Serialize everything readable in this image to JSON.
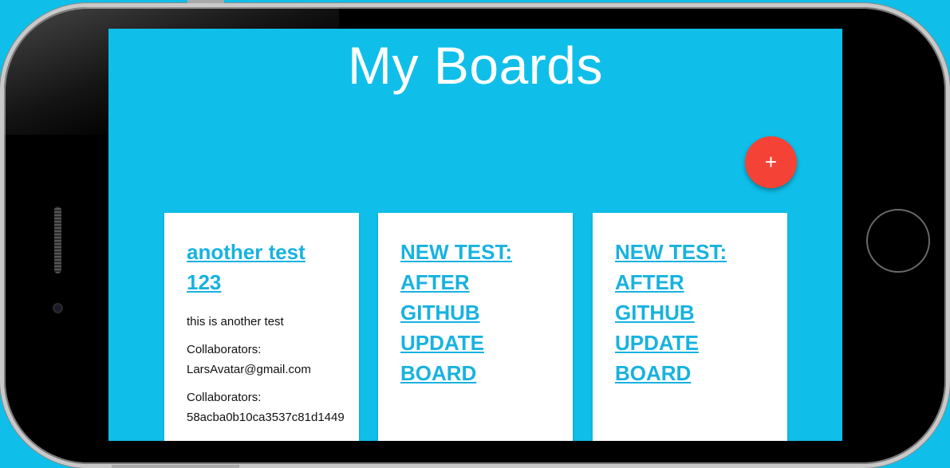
{
  "page": {
    "title": "My Boards"
  },
  "fab": {
    "label": "+"
  },
  "boards": [
    {
      "title_line1": "another test",
      "title_line2": "123",
      "description": "this is another test",
      "collab1_label": "Collaborators:",
      "collab1_value": "LarsAvatar@gmail.com",
      "collab2_label": "Collaborators:",
      "collab2_value": "58acba0b10ca3537c81d1449"
    },
    {
      "title_lines": [
        "NEW TEST:",
        "AFTER",
        "GITHUB",
        "UPDATE",
        "BOARD"
      ]
    },
    {
      "title_lines": [
        "NEW TEST:",
        "AFTER",
        "GITHUB",
        "UPDATE",
        "BOARD"
      ]
    }
  ],
  "colors": {
    "background": "#0fbfe9",
    "fab": "#f44336",
    "link": "#17b2e0"
  }
}
